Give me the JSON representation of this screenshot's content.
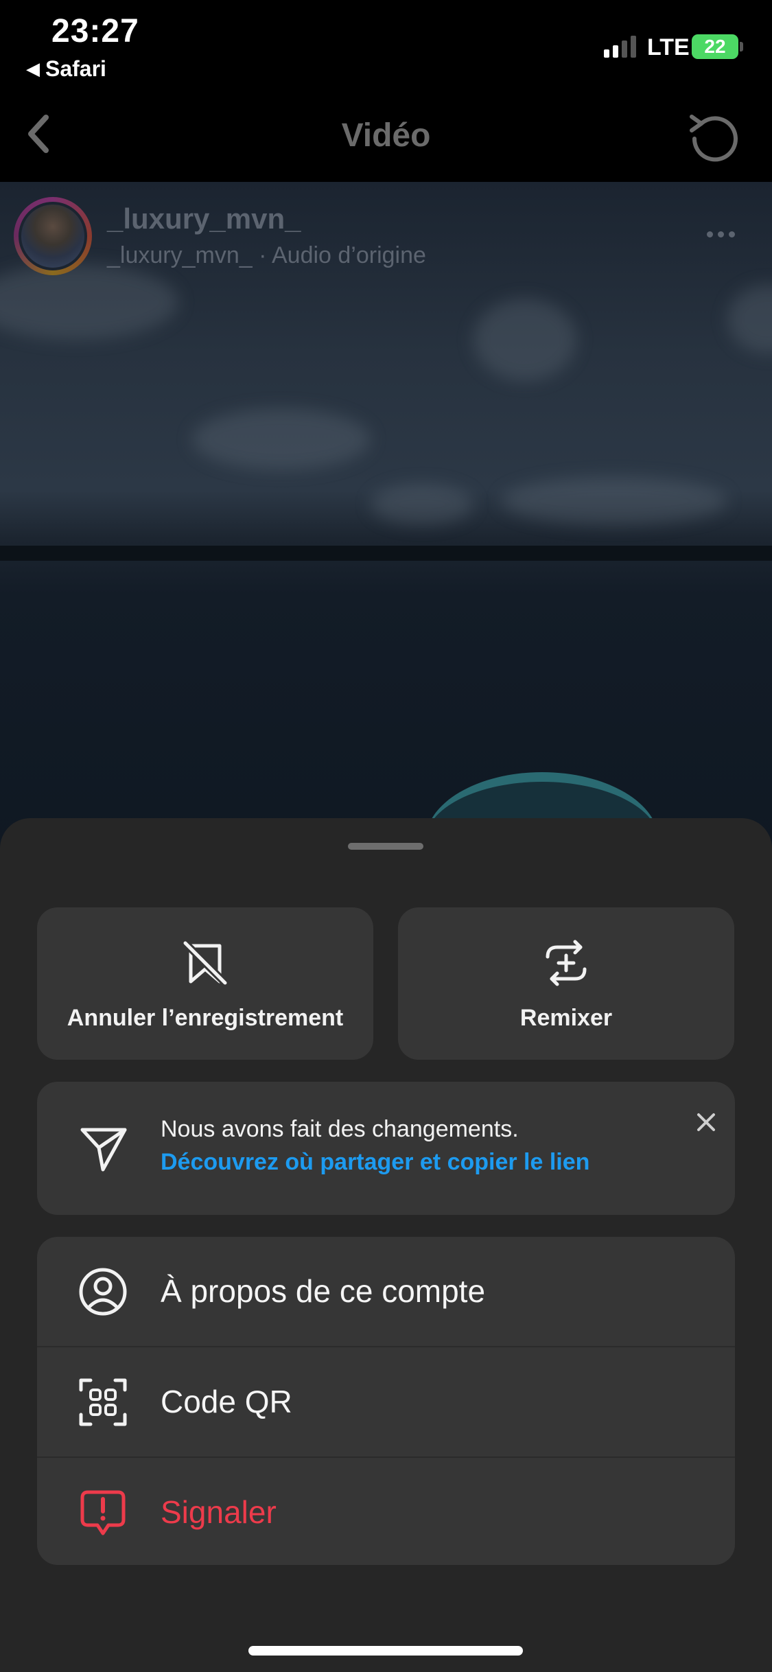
{
  "status_bar": {
    "time": "23:27",
    "back_app": "Safari",
    "back_triangle": "◀",
    "network": "LTE",
    "battery": "22"
  },
  "nav": {
    "title": "Vidéo",
    "back_icon": "chevron-left-icon",
    "refresh_icon": "refresh-icon"
  },
  "post": {
    "username": "_luxury_mvn_",
    "subline": "_luxury_mvn_ · Audio d’origine"
  },
  "sheet": {
    "tiles": [
      {
        "label": "Annuler l’enregistrement",
        "icon": "bookmark-slash-icon"
      },
      {
        "label": "Remixer",
        "icon": "remix-icon"
      }
    ],
    "notice": {
      "text": "Nous avons fait des changements.",
      "link": "Découvrez où partager et copier le lien",
      "icon": "send-icon"
    },
    "menu": [
      {
        "label": "À propos de ce compte",
        "icon": "user-circle-icon"
      },
      {
        "label": "Code QR",
        "icon": "qr-code-icon"
      },
      {
        "label": "Signaler",
        "icon": "report-icon",
        "color": "#ed3b4b"
      }
    ]
  },
  "colors": {
    "sheet_bg": "#262626",
    "card_bg": "#363636",
    "link": "#1d9bf0",
    "danger": "#ed3b4b",
    "battery": "#4cd964"
  }
}
